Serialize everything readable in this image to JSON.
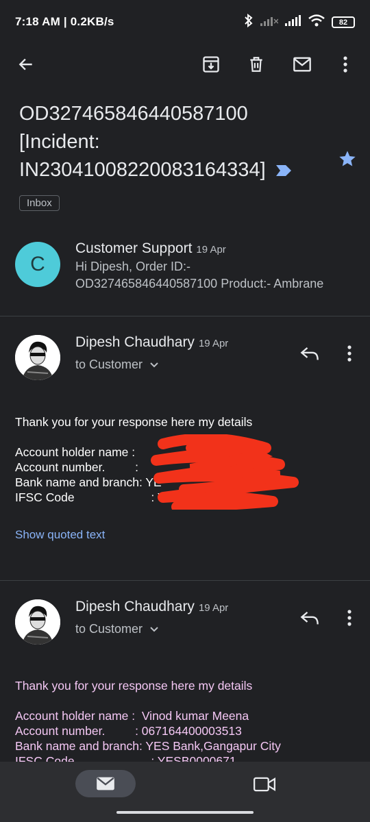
{
  "status_bar": {
    "time_speed": "7:18 AM | 0.2KB/s",
    "battery": "82"
  },
  "app_bar": {
    "icons": [
      "back-arrow-icon",
      "archive-icon",
      "delete-icon",
      "mark-unread-icon",
      "more-vert-icon"
    ]
  },
  "subject": {
    "text": "OD327465846440587100 [Incident: IN2304100822008316 4334]",
    "line1": "OD327465846440587100",
    "line2": "[Incident:",
    "line3": "IN23041008220083164334]",
    "label_color": "#8ab4f8",
    "star_color": "#8ab4f8"
  },
  "label_chip": "Inbox",
  "collapsed_message": {
    "avatar_letter": "C",
    "avatar_color": "#4ecbd9",
    "sender": "Customer Support",
    "date": "19 Apr",
    "snippet_line1": "Hi Dipesh, Order ID:-",
    "snippet_line2": "OD327465846440587100 Product:- Ambrane"
  },
  "message1": {
    "sender": "Dipesh Chaudhary",
    "date": "19 Apr",
    "to": "to Customer",
    "greeting": "Thank you for your response here my details",
    "fields": [
      "Account holder name :",
      "Account number.         :",
      "Bank name and branch: YE",
      "IFSC Code                       : YE"
    ],
    "show_quoted": "Show quoted text",
    "text_color": "#ffffff"
  },
  "message2": {
    "sender": "Dipesh Chaudhary",
    "date": "19 Apr",
    "to": "to Customer",
    "greeting": "Thank you for your response here my details",
    "fields": [
      "Account holder name :  Vinod kumar Meena",
      "Account number.         : 067164400003513",
      "Bank name and branch: YES Bank,Gangapur City",
      "IFSC Code                       : YESB0000671"
    ],
    "text_color": "#f4c7f4"
  },
  "bottom_nav": {
    "mail_icon": "mail-icon",
    "video_icon": "video-camera-icon"
  }
}
